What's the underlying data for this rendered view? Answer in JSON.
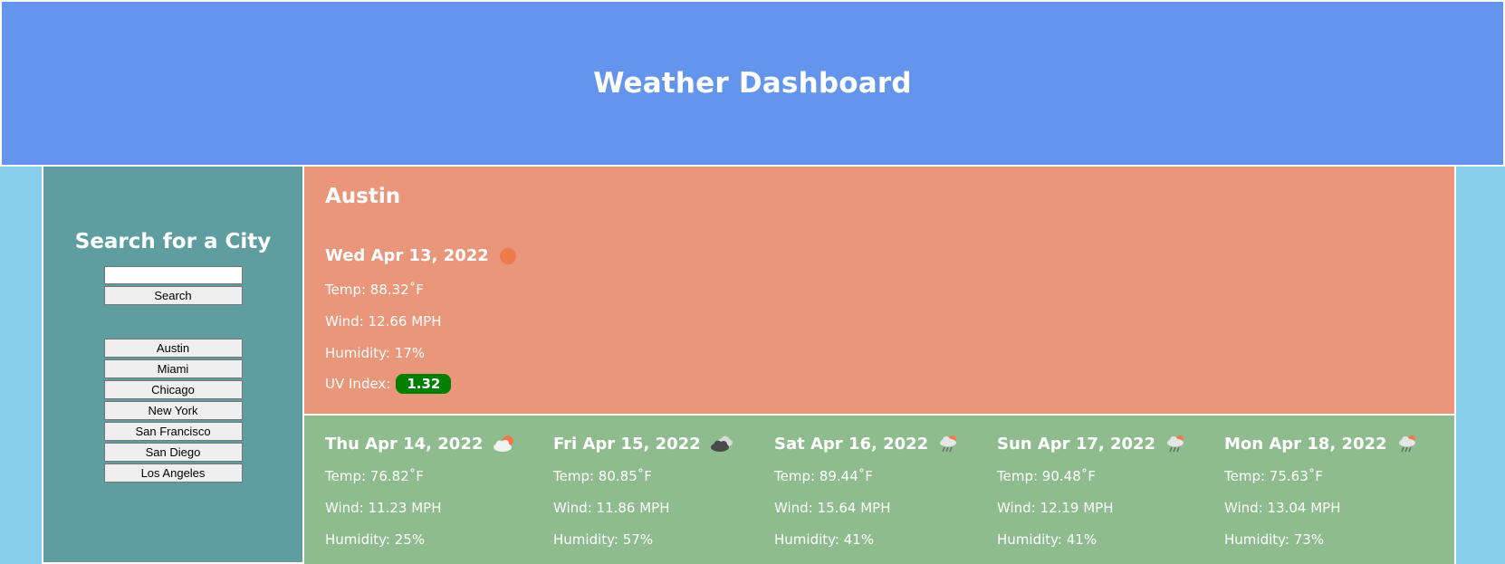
{
  "header": {
    "title": "Weather Dashboard"
  },
  "sidebar": {
    "heading": "Search for a City",
    "search_value": "",
    "search_label": "Search",
    "cities": [
      "Austin",
      "Miami",
      "Chicago",
      "New York",
      "San Francisco",
      "San Diego",
      "Los Angeles"
    ]
  },
  "current": {
    "city": "Austin",
    "date": "Wed Apr 13, 2022",
    "icon": "sun-icon",
    "temp": "Temp: 88.32˚F",
    "wind": "Wind: 12.66 MPH",
    "humidity": "Humidity: 17%",
    "uv_label": "UV Index:",
    "uv_value": "1.32",
    "uv_color": "#008000"
  },
  "forecast": [
    {
      "date": "Thu Apr 14, 2022",
      "icon": "partly-cloudy-icon",
      "temp": "Temp: 76.82˚F",
      "wind": "Wind: 11.23 MPH",
      "humidity": "Humidity: 25%"
    },
    {
      "date": "Fri Apr 15, 2022",
      "icon": "dark-cloud-icon",
      "temp": "Temp: 80.85˚F",
      "wind": "Wind: 11.86 MPH",
      "humidity": "Humidity: 57%"
    },
    {
      "date": "Sat Apr 16, 2022",
      "icon": "rain-icon",
      "temp": "Temp: 89.44˚F",
      "wind": "Wind: 15.64 MPH",
      "humidity": "Humidity: 41%"
    },
    {
      "date": "Sun Apr 17, 2022",
      "icon": "rain-icon",
      "temp": "Temp: 90.48˚F",
      "wind": "Wind: 12.19 MPH",
      "humidity": "Humidity: 41%"
    },
    {
      "date": "Mon Apr 18, 2022",
      "icon": "rain-icon",
      "temp": "Temp: 75.63˚F",
      "wind": "Wind: 13.04 MPH",
      "humidity": "Humidity: 73%"
    }
  ],
  "colors": {
    "header_bg": "#6495ed",
    "sidebar_bg": "#5f9ea0",
    "current_bg": "#e9967a",
    "forecast_bg": "#8fbc8f",
    "page_bg": "#87ceeb"
  }
}
